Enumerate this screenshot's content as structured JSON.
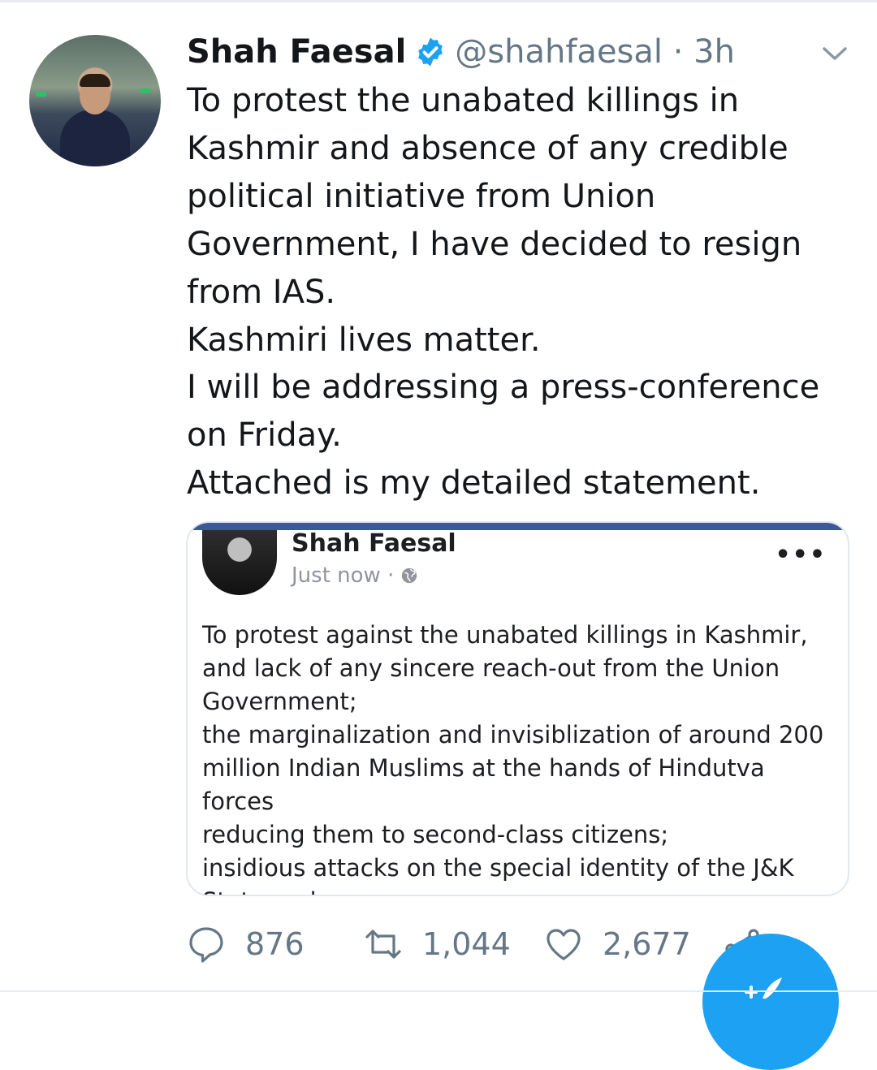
{
  "tweet": {
    "author_name": "Shah Faesal",
    "handle_time": "@shahfaesal · 3h",
    "text": "To protest the unabated killings in\nKashmir and absence of any credible\npolitical initiative from Union\nGovernment, I have decided to resign\nfrom IAS.\nKashmiri lives matter.\nI will be addressing a press-conference\non Friday.\nAttached is my detailed statement."
  },
  "attachment": {
    "author_name": "Shah Faesal",
    "timestamp": "Just now ·",
    "more_label": "•••",
    "text": "To protest against the unabated killings in Kashmir,\nand lack of any sincere reach-out from the Union\nGovernment;\nthe marginalization and invisiblization of around 200\nmillion Indian Muslims at the hands of Hindutva forces\nreducing them to second-class citizens;\ninsidious attacks on the special identity of the J&K\nState and\ngrowing culture of intolerance and hate in the"
  },
  "actions": {
    "replies": "876",
    "retweets": "1,044",
    "likes": "2,677"
  },
  "colors": {
    "accent": "#1da1f2",
    "secondary_text": "#657786",
    "facebook_blue": "#3b5998"
  },
  "icons": [
    "verified-badge-icon",
    "chevron-down-icon",
    "globe-icon",
    "reply-icon",
    "retweet-icon",
    "like-icon",
    "share-icon",
    "compose-tweet-icon"
  ]
}
